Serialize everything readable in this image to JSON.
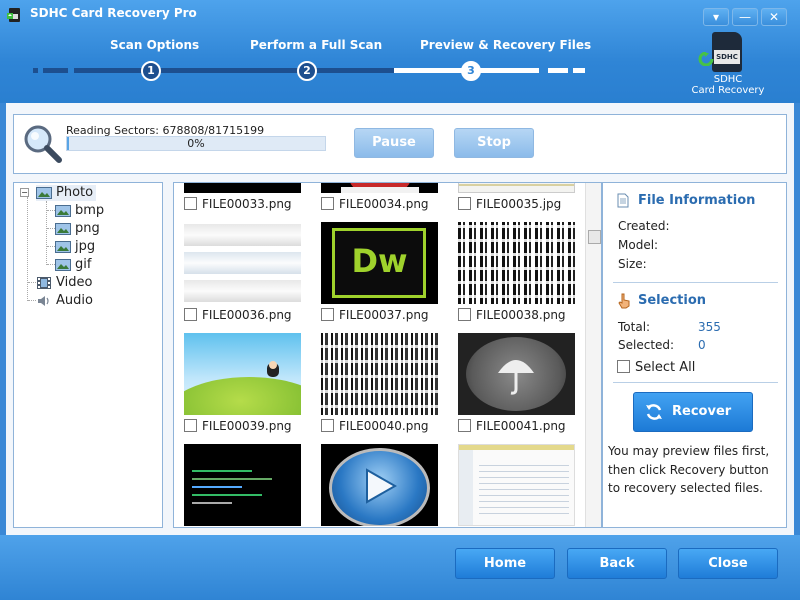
{
  "window": {
    "title": "SDHC Card Recovery Pro",
    "menu_icon": "▾",
    "minimize_icon": "—",
    "close_icon": "✕"
  },
  "steps": [
    {
      "label": "Scan Options",
      "number": "1"
    },
    {
      "label": "Perform a Full Scan",
      "number": "2"
    },
    {
      "label": "Preview & Recovery Files",
      "number": "3"
    }
  ],
  "brand": {
    "card_label": "SDHC",
    "line1": "SDHC",
    "line2": "Card Recovery"
  },
  "scan": {
    "status": "Reading Sectors: 678808/81715199",
    "progress_text": "0%",
    "progress_fraction": 0.0083,
    "pause_label": "Pause",
    "stop_label": "Stop"
  },
  "tree": {
    "photo": "Photo",
    "bmp": "bmp",
    "png": "png",
    "jpg": "jpg",
    "gif": "gif",
    "video": "Video",
    "audio": "Audio",
    "collapse_symbol": "−"
  },
  "files": [
    "FILE00033.png",
    "FILE00034.png",
    "FILE00035.jpg",
    "FILE00036.png",
    "FILE00037.png",
    "FILE00038.png",
    "FILE00039.png",
    "FILE00040.png",
    "FILE00041.png"
  ],
  "thumbs": {
    "dw_text": "Dw"
  },
  "info": {
    "file_info_title": "File Information",
    "created_label": "Created:",
    "model_label": "Model:",
    "size_label": "Size:",
    "selection_title": "Selection",
    "total_label": "Total:",
    "total_value": "355",
    "selected_label": "Selected:",
    "selected_value": "0",
    "select_all_label": "Select All",
    "recover_label": "Recover",
    "hint_text": "You may preview files first, then click Recovery button to recovery selected files."
  },
  "footer": {
    "home_label": "Home",
    "back_label": "Back",
    "close_label": "Close"
  },
  "colors": {
    "header_blue": "#2f85d6",
    "accent_blue": "#2b6cb0",
    "button_blue": "#1f7cd8"
  }
}
